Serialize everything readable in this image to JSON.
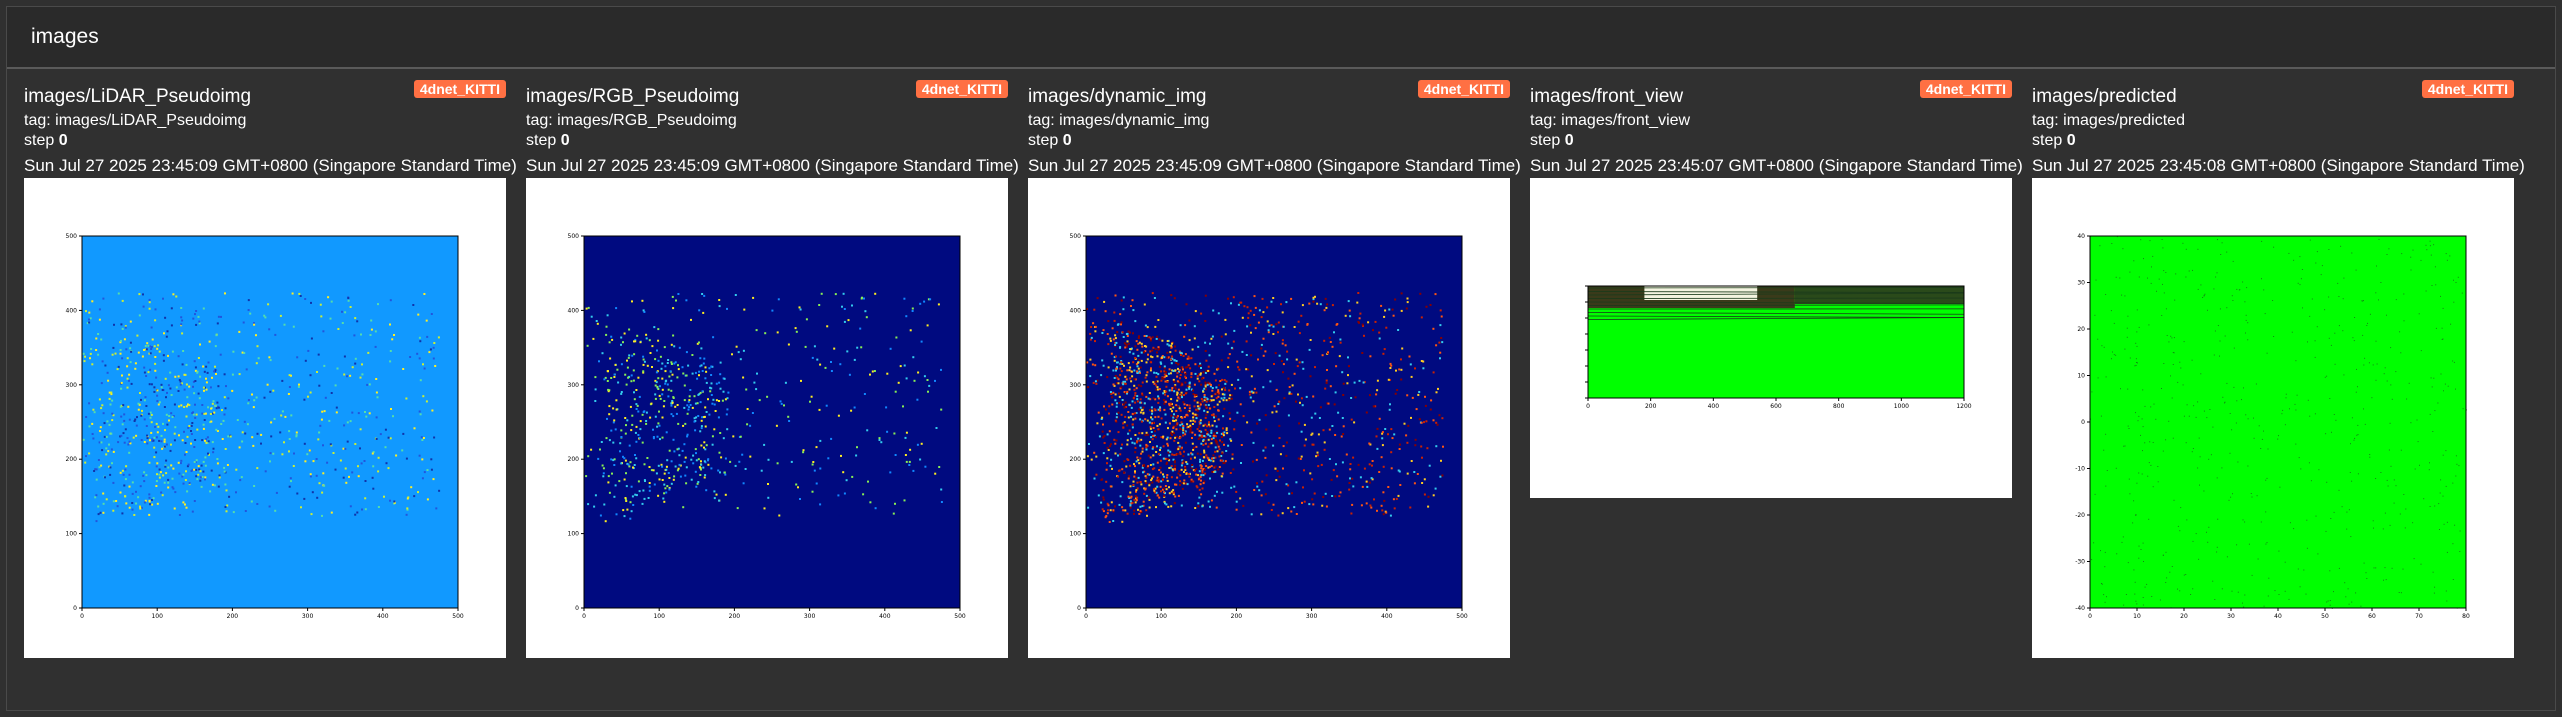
{
  "section": {
    "title": "images"
  },
  "cards": [
    {
      "title": "images/LiDAR_Pseudoimg",
      "run": "4dnet_KITTI",
      "tag_label": "tag: images/LiDAR_Pseudoimg",
      "step_label": "step",
      "step": "0",
      "timestamp": "Sun Jul 27 2025 23:45:09 GMT+0800 (Singapore Standard Time)"
    },
    {
      "title": "images/RGB_Pseudoimg",
      "run": "4dnet_KITTI",
      "tag_label": "tag: images/RGB_Pseudoimg",
      "step_label": "step",
      "step": "0",
      "timestamp": "Sun Jul 27 2025 23:45:09 GMT+0800 (Singapore Standard Time)"
    },
    {
      "title": "images/dynamic_img",
      "run": "4dnet_KITTI",
      "tag_label": "tag: images/dynamic_img",
      "step_label": "step",
      "step": "0",
      "timestamp": "Sun Jul 27 2025 23:45:09 GMT+0800 (Singapore Standard Time)"
    },
    {
      "title": "images/front_view",
      "run": "4dnet_KITTI",
      "tag_label": "tag: images/front_view",
      "step_label": "step",
      "step": "0",
      "timestamp": "Sun Jul 27 2025 23:45:07 GMT+0800 (Singapore Standard Time)"
    },
    {
      "title": "images/predicted",
      "run": "4dnet_KITTI",
      "tag_label": "tag: images/predicted",
      "step_label": "step",
      "step": "0",
      "timestamp": "Sun Jul 27 2025 23:45:08 GMT+0800 (Singapore Standard Time)"
    }
  ],
  "plots": {
    "lidar": {
      "bg": "#1199ff",
      "dots": [
        "#55ddaa",
        "#ccee33",
        "#ffee22",
        "#1133aa",
        "#2255dd"
      ],
      "xticks": [
        "0",
        "100",
        "200",
        "300",
        "400",
        "500"
      ],
      "yticks": [
        "500",
        "400",
        "300",
        "200",
        "100",
        "0"
      ]
    },
    "rgb": {
      "bg": "#000a80",
      "dots": [
        "#ffee22",
        "#88ee55",
        "#33ccee",
        "#1188ff"
      ],
      "xticks": [
        "0",
        "100",
        "200",
        "300",
        "400",
        "500"
      ],
      "yticks": [
        "500",
        "400",
        "300",
        "200",
        "100",
        "0"
      ]
    },
    "dynamic": {
      "bg": "#000a80",
      "dots": [
        "#cc2200",
        "#ff5511",
        "#ffcc22",
        "#880000",
        "#33ccee"
      ],
      "xticks": [
        "0",
        "100",
        "200",
        "300",
        "400",
        "500"
      ],
      "yticks": [
        "500",
        "400",
        "300",
        "200",
        "100",
        "0"
      ]
    },
    "front": {
      "bg": "#00ff00",
      "xticks": [
        "0",
        "200",
        "400",
        "600",
        "800",
        "1000",
        "1200"
      ]
    },
    "predicted": {
      "bg": "#00ff00",
      "xticks": [
        "0",
        "10",
        "20",
        "30",
        "40",
        "50",
        "60",
        "70",
        "80"
      ],
      "yticks": [
        "40",
        "30",
        "20",
        "10",
        "0",
        "-10",
        "-20",
        "-30",
        "-40"
      ]
    }
  }
}
